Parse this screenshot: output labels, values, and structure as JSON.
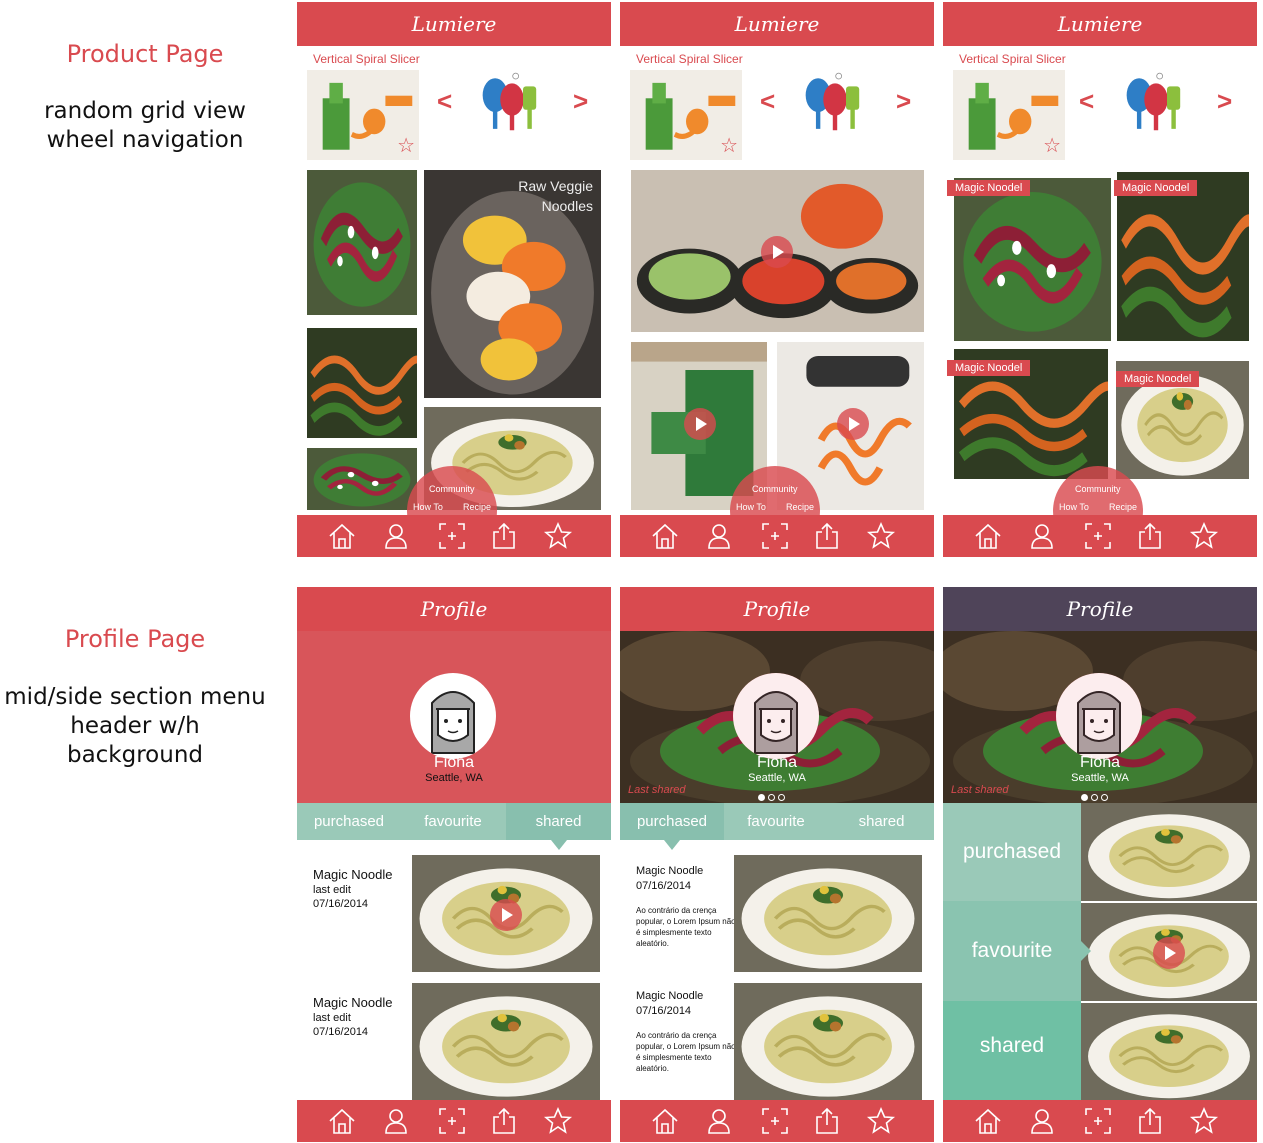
{
  "annotations": {
    "product_title": "Product Page",
    "product_desc_1": "random grid view",
    "product_desc_2": "wheel navigation",
    "profile_title": "Profile Page",
    "profile_desc_1": "mid/side section menu",
    "profile_desc_2": "header w/h background"
  },
  "product_screens": {
    "header_title": "Lumiere",
    "product_name": "Vertical Spiral Slicer",
    "prev_arrow": "<",
    "next_arrow": ">",
    "overlay_text": "Raw Veggie Noodles",
    "tag_label": "Magic Noodel",
    "wheel": {
      "top": "Community",
      "left": "How To",
      "right": "Recipe"
    }
  },
  "profile_screens": {
    "header_title": "Profile",
    "user_name": "Fiona",
    "user_location": "Seattle, WA",
    "last_shared": "Last shared",
    "menu": {
      "purchased": "purchased",
      "favourite": "favourite",
      "shared": "shared"
    },
    "entry": {
      "title": "Magic Noodle",
      "last_edit": "last edit",
      "date": "07/16/2014",
      "body": "Ao contrário da crença popular, o Lorem Ipsum não é simplesmente texto aleatório."
    }
  },
  "tab_icons": [
    "home-icon",
    "profile-icon",
    "scan-icon",
    "share-icon",
    "star-icon"
  ],
  "colors": {
    "accent": "#d94a4f",
    "mint": "#9ac9b8",
    "dark_header": "#4f4459"
  }
}
